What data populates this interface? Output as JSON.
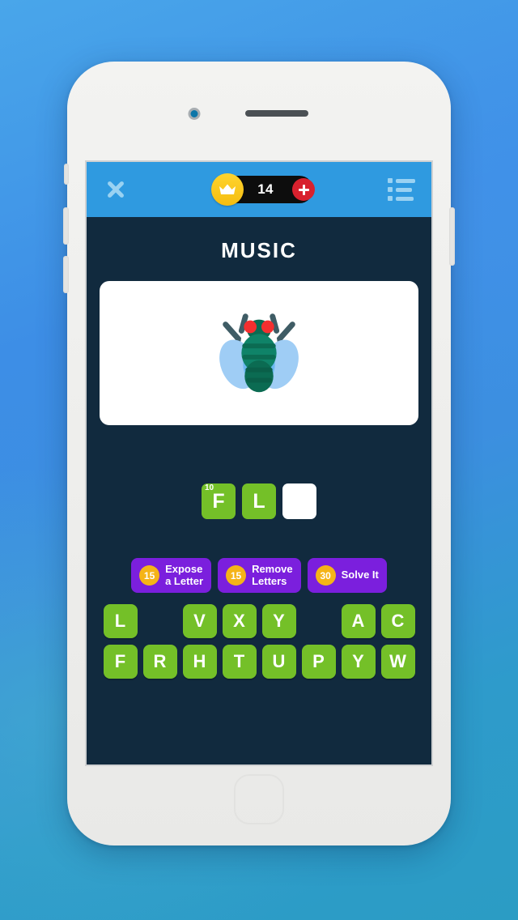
{
  "background": {
    "gradient_from": "#49a6ea",
    "gradient_to": "#2b9cc4"
  },
  "device": {
    "shell_color": "#f0f0ee",
    "camera": "front-camera",
    "speaker": "earpiece-speaker",
    "home_button": "home-button"
  },
  "header": {
    "background": "#2f9ae0",
    "close_icon": "close-icon",
    "menu_icon": "list-menu-icon",
    "coins": {
      "crown_icon": "crown-icon",
      "count": "14",
      "add_label": "+",
      "pill_color": "#0d0d0d",
      "crown_color": "#f5bd10",
      "plus_color": "#d8212e"
    }
  },
  "game": {
    "category": "MUSIC",
    "card_background": "#ffffff",
    "puzzle_emoji_name": "fly-emoji",
    "answer_tiles": [
      {
        "letter": "F",
        "index": "10",
        "state": "filled"
      },
      {
        "letter": "L",
        "index": "",
        "state": "filled"
      },
      {
        "letter": "",
        "index": "",
        "state": "empty"
      }
    ],
    "tile_filled_color": "#74c028",
    "tile_empty_color": "#ffffff"
  },
  "powerups": [
    {
      "cost": "15",
      "label": "Expose\na Letter",
      "name": "expose-a-letter"
    },
    {
      "cost": "15",
      "label": "Remove\nLetters",
      "name": "remove-letters"
    },
    {
      "cost": "30",
      "label": "Solve It",
      "name": "solve-it"
    }
  ],
  "powerup_style": {
    "background": "#7b1fdd",
    "cost_badge": "#f5b417"
  },
  "keyboard": {
    "key_color": "#74c028",
    "rows": [
      [
        "L",
        "",
        "V",
        "X",
        "Y",
        "",
        "A",
        "C"
      ],
      [
        "F",
        "R",
        "H",
        "T",
        "U",
        "P",
        "Y",
        "W"
      ]
    ]
  }
}
